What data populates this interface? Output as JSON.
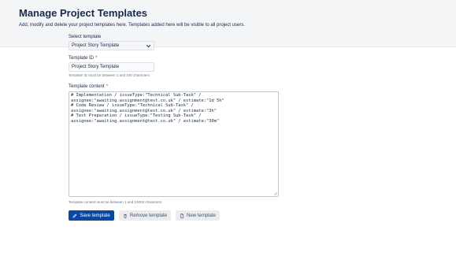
{
  "page": {
    "title": "Manage Project Templates",
    "description": "Add, modify and delete your project templates here. Templates added here will be visible to all project users."
  },
  "select_template": {
    "label": "Select template",
    "value": "Project Story Template"
  },
  "template_id": {
    "label": "Template ID",
    "required_mark": "*",
    "value": "Project Story Template",
    "helper": "Template ID must be between 1 and 100 characters"
  },
  "template_content": {
    "label": "Template content",
    "required_mark": "*",
    "lines": [
      "# Implementation / issueType:\"Technical Sub-Task\" /",
      "assignee:\"awaiting.assignment@test.co.uk\" / estimate:\"1d 5h\"",
      "# Code Review / issueType:\"Technical Sub-Task\" /",
      "assignee:\"awaiting.assignment@test.co.uk\" / estimate:\"3h\"",
      "# Test Preparation / issueType:\"Testing Sub-Task\" /",
      "assignee:\"awaiting.assignment@test.co.uk\" / estimate:\"30m\""
    ],
    "helper": "Template content must be between 1 and 10000 characters"
  },
  "actions": {
    "save_label": "Save template",
    "remove_label": "Remove template",
    "new_label": "New template"
  },
  "colors": {
    "primary": "#0747a6",
    "required": "#de350b",
    "header_bg": "#f4f5f7"
  },
  "icons": [
    "chevron-down-icon",
    "pencil-icon",
    "trash-icon",
    "document-icon"
  ]
}
